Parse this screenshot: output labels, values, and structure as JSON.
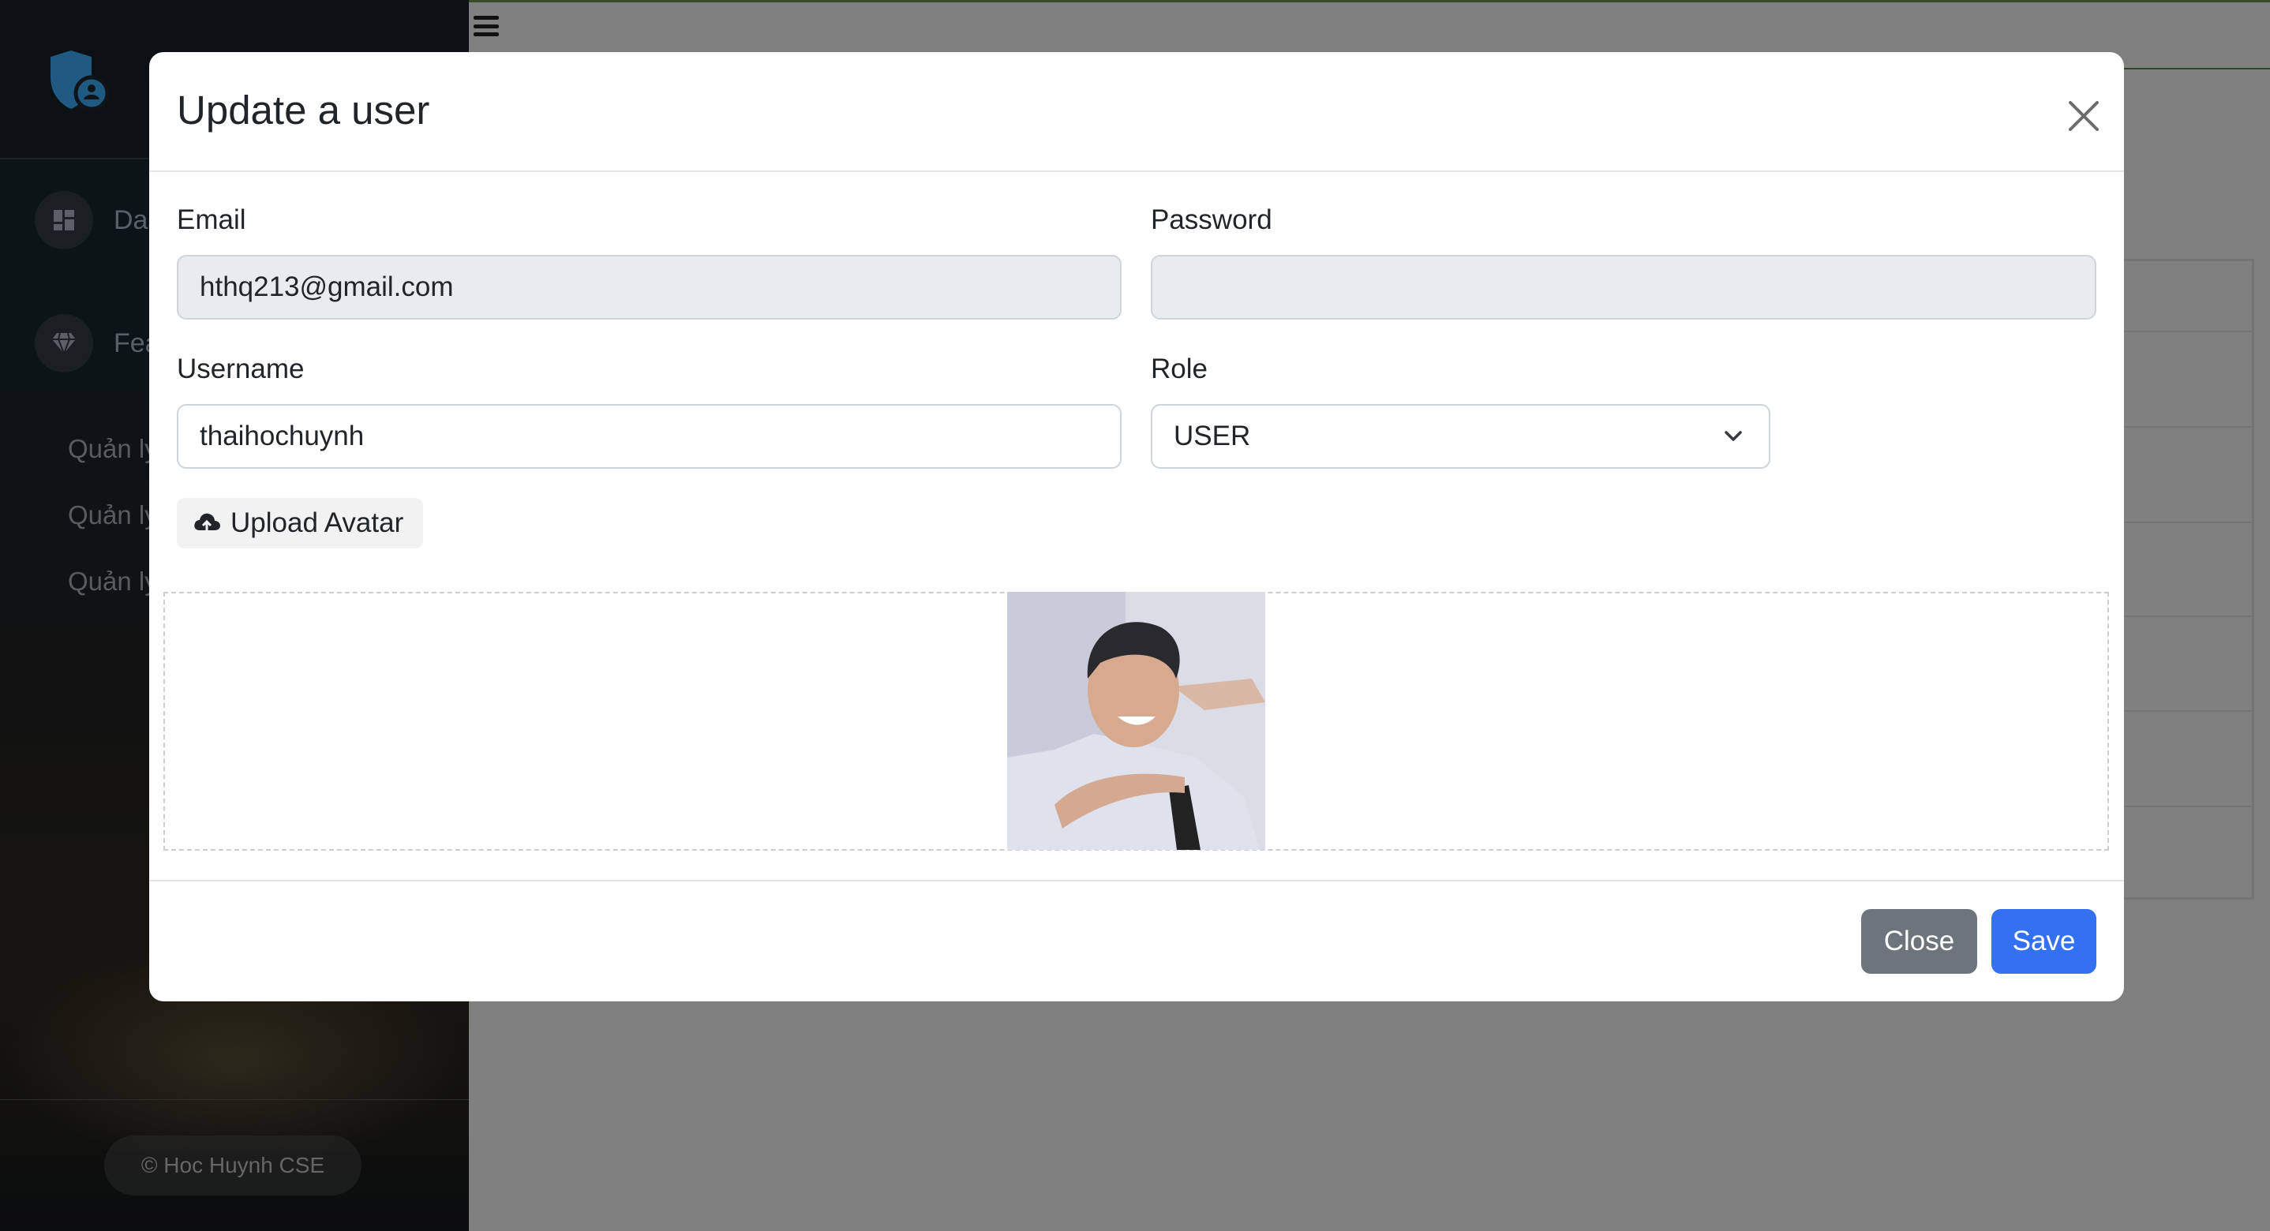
{
  "sidebar": {
    "nav": [
      {
        "label": "Dashboard",
        "icon": "dashboard-icon"
      },
      {
        "label": "Features",
        "icon": "gem-icon"
      }
    ],
    "sub_items": [
      {
        "label": "Quản lý"
      },
      {
        "label": "Quản lý"
      },
      {
        "label": "Quản lý"
      }
    ],
    "footer": "© Hoc Huynh CSE"
  },
  "modal": {
    "title": "Update a user",
    "fields": {
      "email": {
        "label": "Email",
        "value": "hthq213@gmail.com"
      },
      "password": {
        "label": "Password",
        "value": ""
      },
      "username": {
        "label": "Username",
        "value": "thaihochuynh"
      },
      "role": {
        "label": "Role",
        "value": "USER"
      }
    },
    "upload_label": "Upload Avatar",
    "close_label": "Close",
    "save_label": "Save"
  },
  "colors": {
    "primary": "#3370f2",
    "secondary": "#6c757d",
    "logo": "#2d6f9e"
  }
}
